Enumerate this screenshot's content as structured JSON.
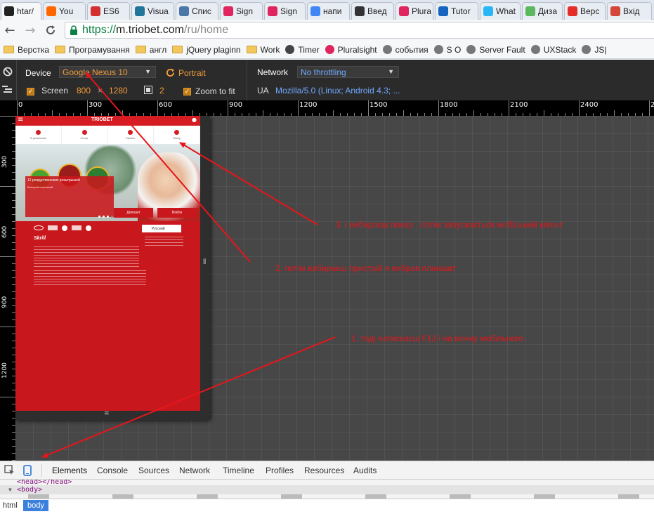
{
  "tabs": [
    {
      "title": "htar/",
      "icon": "github-icon",
      "color": "#222222"
    },
    {
      "title": "You",
      "icon": "ycombinator-icon",
      "color": "#ff6600"
    },
    {
      "title": "ES6",
      "icon": "es6-icon",
      "color": "#d32f2f"
    },
    {
      "title": "Visua",
      "icon": "wordpress-icon",
      "color": "#21759b"
    },
    {
      "title": "Спис",
      "icon": "h-icon",
      "color": "#4a76a8"
    },
    {
      "title": "Sign",
      "icon": "pluralsight-icon",
      "color": "#e0245e"
    },
    {
      "title": "Sign",
      "icon": "pluralsight-icon",
      "color": "#e0245e"
    },
    {
      "title": "напи",
      "icon": "google-icon",
      "color": "#4285f4"
    },
    {
      "title": "Введ",
      "icon": "bookmark-leaf-icon",
      "color": "#333333"
    },
    {
      "title": "Plura",
      "icon": "pluralsight-icon",
      "color": "#e0245e"
    },
    {
      "title": "Tutor",
      "icon": "tutorials-icon",
      "color": "#1565c0"
    },
    {
      "title": "What",
      "icon": "what-icon",
      "color": "#29b6f6"
    },
    {
      "title": "Диза",
      "icon": "freelancer-icon",
      "color": "#5cb85c"
    },
    {
      "title": "Верс",
      "icon": "youtube-icon",
      "color": "#e52d27"
    },
    {
      "title": "Вхід",
      "icon": "gmail-icon",
      "color": "#d44638"
    }
  ],
  "address": {
    "scheme": "https://",
    "host": "m.triobet.com",
    "path": "/ru/home"
  },
  "bookmarks": [
    {
      "label": "Верстка",
      "icon": "folder-icon"
    },
    {
      "label": "Програмування",
      "icon": "folder-icon"
    },
    {
      "label": "англ",
      "icon": "folder-icon"
    },
    {
      "label": "jQuery plaginn",
      "icon": "folder-icon"
    },
    {
      "label": "Work",
      "icon": "folder-icon"
    },
    {
      "label": "Timer",
      "icon": "timer-icon"
    },
    {
      "label": "Pluralsight",
      "icon": "pluralsight-icon"
    },
    {
      "label": "события",
      "icon": "event-icon"
    },
    {
      "label": "S O",
      "icon": "stackoverflow-icon"
    },
    {
      "label": "Server Fault",
      "icon": "serverfault-icon"
    },
    {
      "label": "UXStack",
      "icon": "uxstack-icon"
    },
    {
      "label": "JS|",
      "icon": "js-icon"
    }
  ],
  "emulation": {
    "device_label": "Device",
    "device_value": "Google Nexus 10",
    "orientation": "Portrait",
    "screen_label": "Screen",
    "screen_w": "800",
    "screen_x": "×",
    "screen_h": "1280",
    "dpr": "2",
    "zoom_label": "Zoom to fit",
    "network_label": "Network",
    "network_value": "No throttling",
    "ua_label": "UA",
    "ua_value": "Mozilla/5.0 (Linux; Android 4.3; ..."
  },
  "ruler": {
    "h_ticks": [
      "0",
      "300",
      "600",
      "900",
      "1200",
      "1500",
      "1800",
      "2100",
      "2400",
      "2700"
    ],
    "v_ticks": [
      "300",
      "600",
      "900",
      "1200"
    ]
  },
  "mobile_site": {
    "logo": "TRIOBET",
    "nav": [
      "В реальном",
      "Спорт",
      "Казино",
      "Покер"
    ],
    "promo_title": "12 рождественских розыгрышей",
    "promo_line": "Выиграй новенький",
    "deposit_btn": "Депозит",
    "login_btn": "Войти",
    "language": "Русский",
    "skrill": "Skrill"
  },
  "annotations": [
    {
      "text": "3. і вибираєш покер , потім запускається мобільний клієнт"
    },
    {
      "text": "2. потім вибираєш пристрій я вибрав планшат"
    },
    {
      "text": "1. тоді натискаєш F12 і на іконку мобільного"
    }
  ],
  "devtools": {
    "tabs": [
      "Elements",
      "Console",
      "Sources",
      "Network",
      "Timeline",
      "Profiles",
      "Resources",
      "Audits"
    ],
    "active_tab": "Elements",
    "code_line_1": "<head></head>",
    "code_line_2": "<body>",
    "breadcrumb_html": "html",
    "breadcrumb_body": "body"
  },
  "colors": {
    "accent": "#e8151b",
    "brand_red": "#c9181d",
    "devtools_blue": "#3a80dc",
    "annotation": "#e8151b"
  }
}
